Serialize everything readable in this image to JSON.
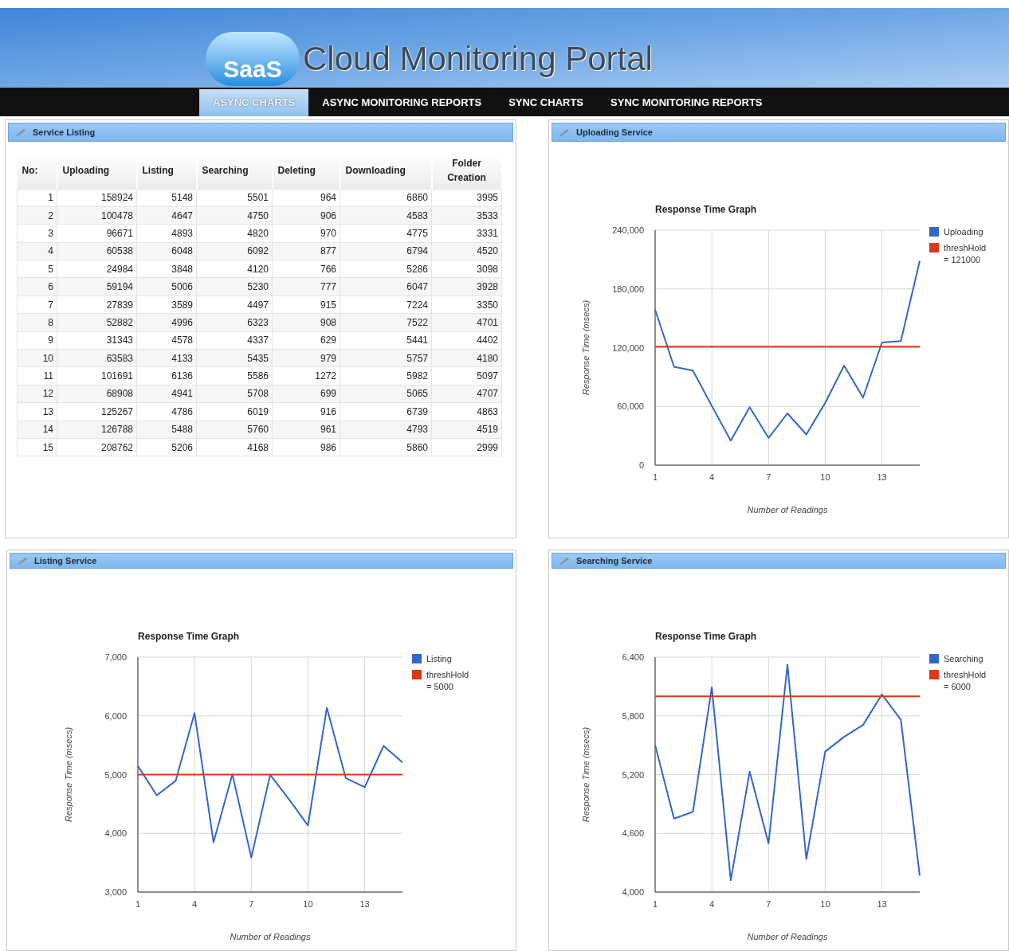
{
  "header": {
    "logo_badge": "SaaS",
    "title": "Cloud Monitoring Portal"
  },
  "nav": [
    {
      "label": "ASYNC CHARTS",
      "selected": true
    },
    {
      "label": "ASYNC MONITORING REPORTS",
      "selected": false
    },
    {
      "label": "SYNC CHARTS",
      "selected": false
    },
    {
      "label": "SYNC MONITORING REPORTS",
      "selected": false
    }
  ],
  "service_listing": {
    "title": "Service Listing",
    "table": {
      "columns": [
        "No:",
        "Uploading",
        "Listing",
        "Searching",
        "Deleting",
        "Downloading",
        "Folder Creation"
      ],
      "rows": [
        [
          "1",
          "158924",
          "5148",
          "5501",
          "964",
          "6860",
          "3995"
        ],
        [
          "2",
          "100478",
          "4647",
          "4750",
          "906",
          "4583",
          "3533"
        ],
        [
          "3",
          "96671",
          "4893",
          "4820",
          "970",
          "4775",
          "3331"
        ],
        [
          "4",
          "60538",
          "6048",
          "6092",
          "877",
          "6794",
          "4520"
        ],
        [
          "5",
          "24984",
          "3848",
          "4120",
          "766",
          "5286",
          "3098"
        ],
        [
          "6",
          "59194",
          "5006",
          "5230",
          "777",
          "6047",
          "3928"
        ],
        [
          "7",
          "27839",
          "3589",
          "4497",
          "915",
          "7224",
          "3350"
        ],
        [
          "8",
          "52882",
          "4996",
          "6323",
          "908",
          "7522",
          "4701"
        ],
        [
          "9",
          "31343",
          "4578",
          "4337",
          "629",
          "5441",
          "4402"
        ],
        [
          "10",
          "63583",
          "4133",
          "5435",
          "979",
          "5757",
          "4180"
        ],
        [
          "11",
          "101691",
          "6136",
          "5586",
          "1272",
          "5982",
          "5097"
        ],
        [
          "12",
          "68908",
          "4941",
          "5708",
          "699",
          "5065",
          "4707"
        ],
        [
          "13",
          "125267",
          "4786",
          "6019",
          "916",
          "6739",
          "4863"
        ],
        [
          "14",
          "126788",
          "5488",
          "5760",
          "961",
          "4793",
          "4519"
        ],
        [
          "15",
          "208762",
          "5206",
          "4168",
          "986",
          "5860",
          "2999"
        ]
      ]
    }
  },
  "chart_panels": [
    {
      "title": "Uploading Service",
      "chart_data": {
        "type": "line",
        "grid": true,
        "legend": "right",
        "title": "Response Time Graph",
        "xlabel": "Number of Readings",
        "ylabel": "Response Time (msecs)",
        "x": [
          1,
          2,
          3,
          4,
          5,
          6,
          7,
          8,
          9,
          10,
          11,
          12,
          13,
          14,
          15
        ],
        "xlim": [
          1,
          15
        ],
        "ylim": [
          0,
          240000
        ],
        "xticks": [
          1,
          4,
          7,
          10,
          13
        ],
        "yticks": [
          {
            "value": 0,
            "label": "0"
          },
          {
            "value": 60000,
            "label": "60,000"
          },
          {
            "value": 120000,
            "label": "120,000"
          },
          {
            "value": 180000,
            "label": "180,000"
          },
          {
            "value": 240000,
            "label": "240,000"
          }
        ],
        "series": [
          {
            "name": "Uploading",
            "color": "#3366cc",
            "values": [
              158924,
              100478,
              96671,
              60538,
              24984,
              59194,
              27839,
              52882,
              31343,
              63583,
              101691,
              68908,
              125267,
              126788,
              208762
            ]
          },
          {
            "name": "threshHold = 121000",
            "color": "#dc3912",
            "values": [
              121000,
              121000,
              121000,
              121000,
              121000,
              121000,
              121000,
              121000,
              121000,
              121000,
              121000,
              121000,
              121000,
              121000,
              121000
            ]
          }
        ]
      }
    },
    {
      "title": "Listing Service",
      "chart_data": {
        "type": "line",
        "grid": true,
        "legend": "right",
        "title": "Response Time Graph",
        "xlabel": "Number of Readings",
        "ylabel": "Response Time (msecs)",
        "x": [
          1,
          2,
          3,
          4,
          5,
          6,
          7,
          8,
          9,
          10,
          11,
          12,
          13,
          14,
          15
        ],
        "xlim": [
          1,
          15
        ],
        "ylim": [
          3000,
          7000
        ],
        "xticks": [
          1,
          4,
          7,
          10,
          13
        ],
        "yticks": [
          {
            "value": 3000,
            "label": "3,000"
          },
          {
            "value": 4000,
            "label": "4,000"
          },
          {
            "value": 5000,
            "label": "5,000"
          },
          {
            "value": 6000,
            "label": "6,000"
          },
          {
            "value": 7000,
            "label": "7,000"
          }
        ],
        "series": [
          {
            "name": "Listing",
            "color": "#3366cc",
            "values": [
              5148,
              4647,
              4893,
              6048,
              3848,
              5006,
              3589,
              4996,
              4578,
              4133,
              6136,
              4941,
              4786,
              5488,
              5206
            ]
          },
          {
            "name": "threshHold = 5000",
            "color": "#dc3912",
            "values": [
              5000,
              5000,
              5000,
              5000,
              5000,
              5000,
              5000,
              5000,
              5000,
              5000,
              5000,
              5000,
              5000,
              5000,
              5000
            ]
          }
        ]
      }
    },
    {
      "title": "Searching Service",
      "chart_data": {
        "type": "line",
        "grid": true,
        "legend": "right",
        "title": "Response Time Graph",
        "xlabel": "Number of Readings",
        "ylabel": "Response Time (msecs)",
        "x": [
          1,
          2,
          3,
          4,
          5,
          6,
          7,
          8,
          9,
          10,
          11,
          12,
          13,
          14,
          15
        ],
        "xlim": [
          1,
          15
        ],
        "ylim": [
          4000,
          6400
        ],
        "xticks": [
          1,
          4,
          7,
          10,
          13
        ],
        "yticks": [
          {
            "value": 4000,
            "label": "4,000"
          },
          {
            "value": 4600,
            "label": "4,600"
          },
          {
            "value": 5200,
            "label": "5,200"
          },
          {
            "value": 5800,
            "label": "5,800"
          },
          {
            "value": 6400,
            "label": "6,400"
          }
        ],
        "series": [
          {
            "name": "Searching",
            "color": "#3366cc",
            "values": [
              5501,
              4750,
              4820,
              6092,
              4120,
              5230,
              4497,
              6323,
              4337,
              5435,
              5586,
              5708,
              6019,
              5760,
              4168
            ]
          },
          {
            "name": "threshHold = 6000",
            "color": "#dc3912",
            "values": [
              6000,
              6000,
              6000,
              6000,
              6000,
              6000,
              6000,
              6000,
              6000,
              6000,
              6000,
              6000,
              6000,
              6000,
              6000
            ]
          }
        ]
      }
    }
  ]
}
